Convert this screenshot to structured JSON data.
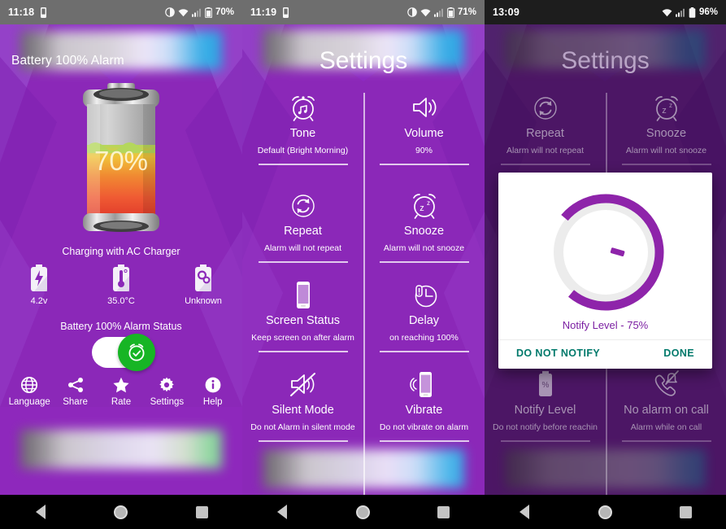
{
  "panels": [
    {
      "id": "home",
      "status": {
        "time": "11:18",
        "battery": "70%",
        "icons": [
          "do-not-disturb-icon",
          "wifi-icon",
          "signal-icon",
          "battery-icon"
        ]
      },
      "app_title": "Battery 100% Alarm",
      "battery_percent": "70%",
      "battery_level": 70,
      "charging_text": "Charging with AC Charger",
      "stats": [
        {
          "icon": "battery-voltage-icon",
          "label": "4.2v"
        },
        {
          "icon": "battery-temperature-icon",
          "label": "35.0°C"
        },
        {
          "icon": "battery-health-icon",
          "label": "Unknown"
        }
      ],
      "alarm_status_label": "Battery 100% Alarm Status",
      "alarm_toggle_on": true,
      "toggle_color": "#17B525",
      "bottom_bar": [
        {
          "icon": "globe-icon",
          "label": "Language"
        },
        {
          "icon": "share-icon",
          "label": "Share"
        },
        {
          "icon": "star-icon",
          "label": "Rate"
        },
        {
          "icon": "gear-icon",
          "label": "Settings"
        },
        {
          "icon": "info-icon",
          "label": "Help"
        }
      ]
    },
    {
      "id": "settings",
      "status": {
        "time": "11:19",
        "battery": "71%",
        "icons": [
          "do-not-disturb-icon",
          "wifi-icon",
          "signal-icon",
          "battery-icon"
        ]
      },
      "title": "Settings",
      "items": [
        {
          "icon": "alarm-tone-icon",
          "name": "Tone",
          "desc": "Default (Bright Morning)"
        },
        {
          "icon": "volume-icon",
          "name": "Volume",
          "desc": "90%"
        },
        {
          "icon": "repeat-icon",
          "name": "Repeat",
          "desc": "Alarm will not repeat"
        },
        {
          "icon": "snooze-icon",
          "name": "Snooze",
          "desc": "Alarm will not snooze"
        },
        {
          "icon": "screen-status-icon",
          "name": "Screen Status",
          "desc": "Keep screen on after alarm"
        },
        {
          "icon": "delay-clock-icon",
          "name": "Delay",
          "desc": "on reaching 100%"
        },
        {
          "icon": "silent-mode-icon",
          "name": "Silent Mode",
          "desc": "Do not Alarm in silent mode"
        },
        {
          "icon": "vibrate-icon",
          "name": "Vibrate",
          "desc": "Do not vibrate on alarm"
        }
      ]
    },
    {
      "id": "settings-dialog",
      "status": {
        "time": "13:09",
        "battery": "96%",
        "icons": [
          "wifi-icon",
          "signal-icon",
          "battery-icon"
        ]
      },
      "title": "Settings",
      "items": [
        {
          "icon": "repeat-icon",
          "name": "Repeat",
          "desc": "Alarm will not repeat"
        },
        {
          "icon": "snooze-icon",
          "name": "Snooze",
          "desc": "Alarm will not snooze"
        },
        {
          "icon": "notify-level-icon",
          "name": "Notify Level",
          "desc": "Do not notify before reachin"
        },
        {
          "icon": "no-call-alarm-icon",
          "name": "No alarm on call",
          "desc": "Alarm while on call"
        }
      ],
      "dialog": {
        "knob_label": "Notify Level - 75%",
        "knob_value": 75,
        "accent_color": "#8E24AA",
        "negative_button": "DO NOT NOTIFY",
        "positive_button": "DONE",
        "button_color": "#00796B"
      }
    }
  ],
  "navbar": {
    "buttons": [
      {
        "icon": "back-triangle-icon"
      },
      {
        "icon": "home-circle-icon"
      },
      {
        "icon": "recents-square-icon"
      }
    ]
  }
}
